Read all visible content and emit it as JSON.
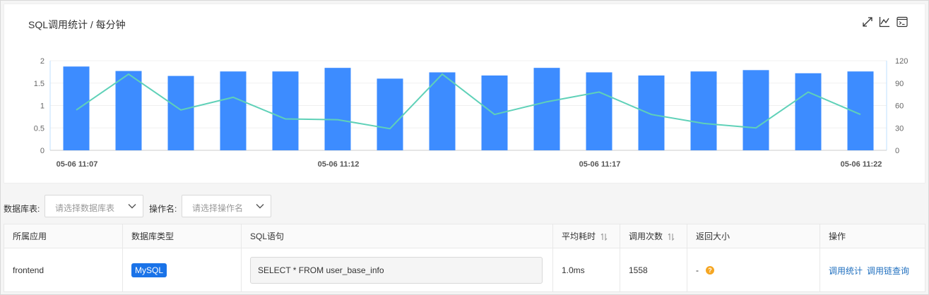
{
  "chart_title": "SQL调用统计 / 每分钟",
  "toolbar": {
    "expand_icon": "expand-icon",
    "line_icon": "line-chart-icon",
    "console_icon": "console-icon"
  },
  "chart_data": {
    "type": "bar",
    "x_tick_labels": [
      "05-06 11:07",
      "05-06 11:12",
      "05-06 11:17",
      "05-06 11:22"
    ],
    "y_left_ticks": [
      "0",
      "0.5",
      "1",
      "1.5",
      "2"
    ],
    "y_right_ticks": [
      "0",
      "30",
      "60",
      "90",
      "120"
    ],
    "ylim_left": [
      0,
      2
    ],
    "ylim_right": [
      0,
      120
    ],
    "series": [
      {
        "type": "bar",
        "axis": "left",
        "color": "#3d8cff",
        "values": [
          1.87,
          1.77,
          1.66,
          1.76,
          1.76,
          1.84,
          1.6,
          1.74,
          1.67,
          1.84,
          1.74,
          1.67,
          1.76,
          1.79,
          1.72,
          1.76
        ]
      },
      {
        "type": "line",
        "axis": "right",
        "color": "#5fd1b8",
        "values": [
          54,
          102,
          54,
          71,
          42,
          41,
          29,
          102,
          48,
          65,
          78,
          48,
          36,
          30,
          78,
          48
        ]
      }
    ]
  },
  "filters": {
    "db_label": "数据库表:",
    "db_placeholder": "请选择数据库表",
    "op_label": "操作名:",
    "op_placeholder": "请选择操作名"
  },
  "table": {
    "headers": {
      "app": "所属应用",
      "db_type": "数据库类型",
      "sql": "SQL语句",
      "avg_time": "平均耗时",
      "calls": "调用次数",
      "return_size": "返回大小",
      "actions": "操作"
    },
    "rows": [
      {
        "app": "frontend",
        "db_type": "MySQL",
        "sql": "SELECT * FROM user_base_info",
        "avg_time": "1.0ms",
        "calls": "1558",
        "return_size": "-",
        "action_stats": "调用统计",
        "action_trace": "调用链查询"
      }
    ]
  }
}
